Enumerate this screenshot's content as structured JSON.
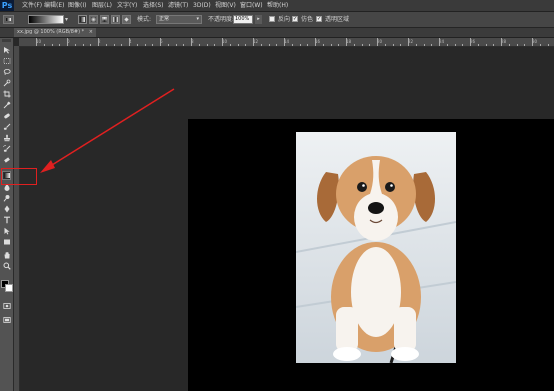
{
  "app": {
    "logo": "Ps"
  },
  "menu": [
    {
      "label": "文件(F)"
    },
    {
      "label": "编辑(E)"
    },
    {
      "label": "图像(I)"
    },
    {
      "label": "图层(L)"
    },
    {
      "label": "文字(Y)"
    },
    {
      "label": "选择(S)"
    },
    {
      "label": "滤镜(T)"
    },
    {
      "label": "3D(D)"
    },
    {
      "label": "视图(V)"
    },
    {
      "label": "窗口(W)"
    },
    {
      "label": "帮助(H)"
    }
  ],
  "options": {
    "mode_label": "模式:",
    "mode_value": "正常",
    "opacity_label": "不透明度:",
    "opacity_value": "100%",
    "reverse_label": "反向",
    "dither_label": "仿色",
    "transparency_label": "透明区域"
  },
  "document": {
    "tab_label": "xx.jpg @ 100% (RGB/8#) *"
  },
  "ruler": [
    "10",
    "0",
    "2",
    "4",
    "6",
    "8",
    "10",
    "12",
    "14",
    "16",
    "18",
    "20",
    "22",
    "24",
    "26",
    "28",
    "30"
  ],
  "colors": {
    "highlight": "#e02020",
    "arrow": "#e02020",
    "canvas": "#000000",
    "workspace": "#282828"
  },
  "tools": [
    "move-tool-icon",
    "marquee-tool-icon",
    "lasso-tool-icon",
    "quick-select-tool-icon",
    "crop-tool-icon",
    "eyedropper-tool-icon",
    "spot-heal-tool-icon",
    "brush-tool-icon",
    "clone-stamp-tool-icon",
    "history-brush-tool-icon",
    "eraser-tool-icon",
    "gradient-tool-icon",
    "blur-tool-icon",
    "dodge-tool-icon",
    "pen-tool-icon",
    "type-tool-icon",
    "path-select-tool-icon",
    "shape-tool-icon",
    "hand-tool-icon",
    "zoom-tool-icon"
  ]
}
